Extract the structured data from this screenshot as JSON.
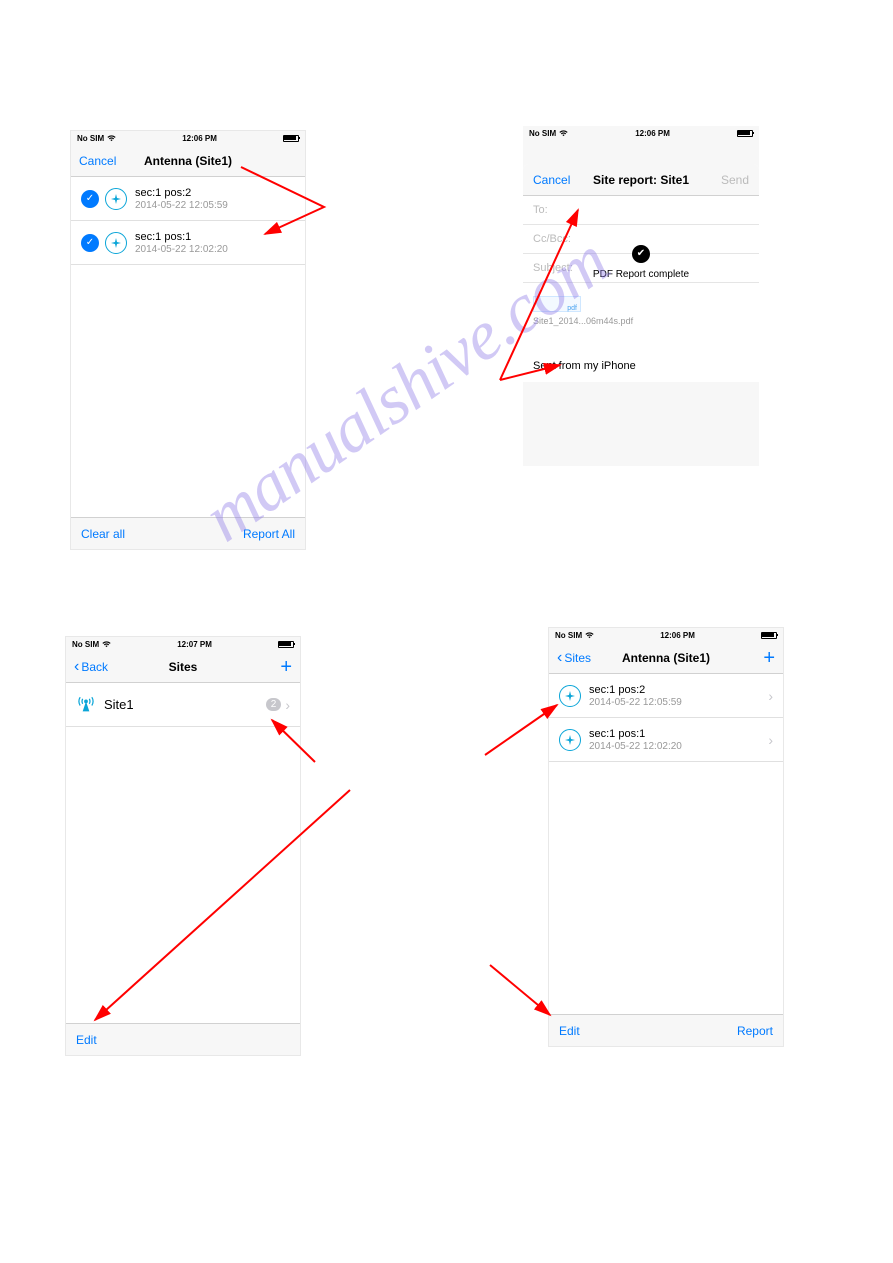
{
  "watermark": "manualshive.com",
  "phone1": {
    "statusbar": {
      "carrier": "No SIM",
      "time": "12:06 PM"
    },
    "nav": {
      "left": "Cancel",
      "title": "Antenna (Site1)"
    },
    "rows": [
      {
        "title": "sec:1  pos:2",
        "subtitle": "2014-05-22 12:05:59"
      },
      {
        "title": "sec:1  pos:1",
        "subtitle": "2014-05-22 12:02:20"
      }
    ],
    "toolbar": {
      "left": "Clear all",
      "right": "Report All"
    }
  },
  "phone2": {
    "statusbar": {
      "carrier": "No SIM",
      "time": "12:06 PM"
    },
    "nav": {
      "left": "Cancel",
      "title": "Site report: Site1",
      "right": "Send"
    },
    "fields": {
      "to": "To:",
      "cc": "Cc/Bcc:",
      "subject": "Subject:"
    },
    "toast": "PDF Report complete",
    "attachment_label": "pdf",
    "attachment_name": "Site1_2014...06m44s.pdf",
    "signature": "Sent from my iPhone"
  },
  "phone3": {
    "statusbar": {
      "carrier": "No SIM",
      "time": "12:07 PM"
    },
    "nav": {
      "left": "Back",
      "title": "Sites"
    },
    "row": {
      "title": "Site1",
      "badge": "2"
    },
    "toolbar": {
      "left": "Edit"
    }
  },
  "phone4": {
    "statusbar": {
      "carrier": "No SIM",
      "time": "12:06 PM"
    },
    "nav": {
      "left": "Sites",
      "title": "Antenna (Site1)"
    },
    "rows": [
      {
        "title": "sec:1  pos:2",
        "subtitle": "2014-05-22 12:05:59"
      },
      {
        "title": "sec:1  pos:1",
        "subtitle": "2014-05-22 12:02:20"
      }
    ],
    "toolbar": {
      "left": "Edit",
      "right": "Report"
    }
  }
}
